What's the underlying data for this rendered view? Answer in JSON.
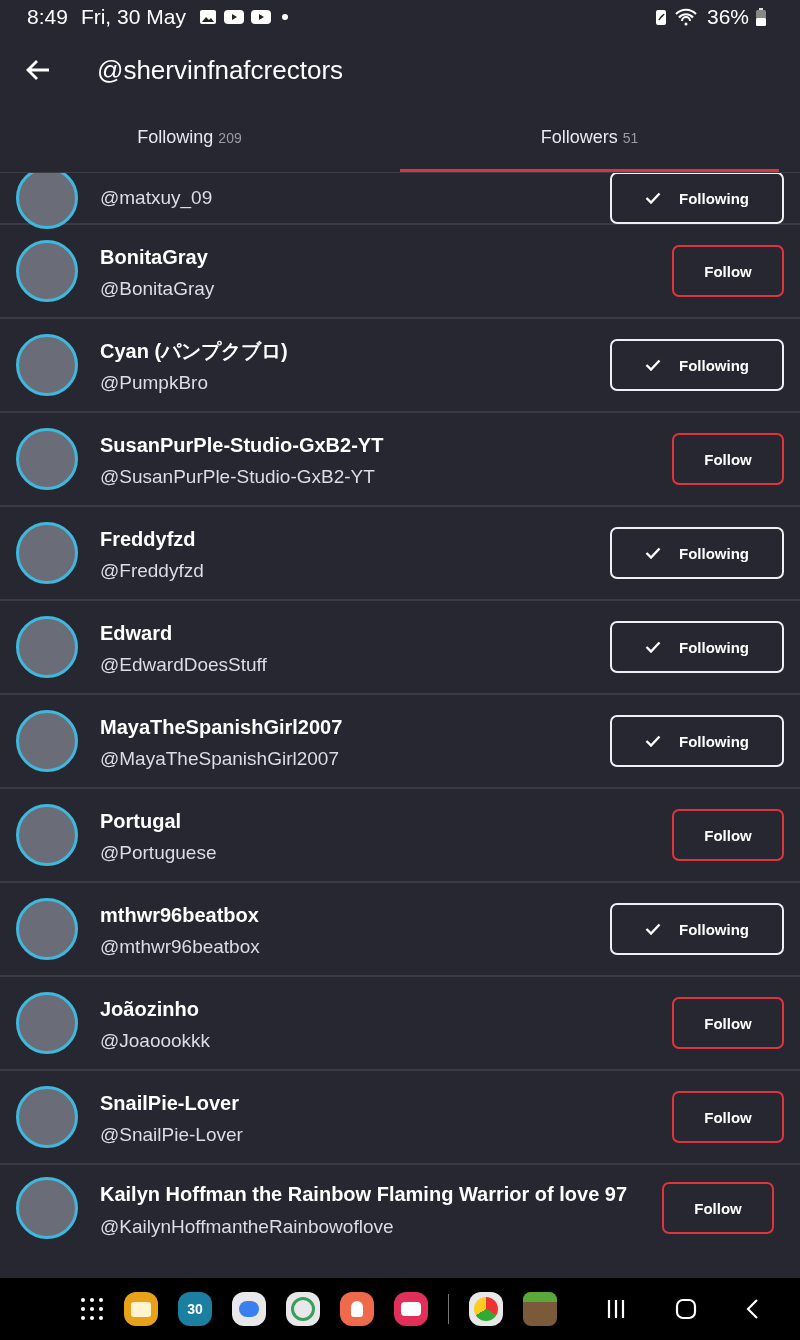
{
  "status_bar": {
    "time": "8:49",
    "date": "Fri, 30 May",
    "battery": "36%"
  },
  "header": {
    "title": "@shervinfnafcrectors"
  },
  "tabs": [
    {
      "label": "Following",
      "count": "209",
      "selected": false
    },
    {
      "label": "Followers",
      "count": "51",
      "selected": true
    }
  ],
  "users": [
    {
      "handle": "@matxuy_09",
      "following": true,
      "button": "Following"
    },
    {
      "name": "BonitaGray",
      "handle": "@BonitaGray",
      "following": false,
      "button": "Follow"
    },
    {
      "name": "Cyan (パンプクブロ)",
      "handle": "@PumpkBro",
      "following": true,
      "button": "Following"
    },
    {
      "name": "SusanPurPle-Studio-GxB2-YT",
      "handle": "@SusanPurPle-Studio-GxB2-YT",
      "following": false,
      "button": "Follow"
    },
    {
      "name": "Freddyfzd",
      "handle": "@Freddyfzd",
      "following": true,
      "button": "Following"
    },
    {
      "name": "Edward",
      "handle": "@EdwardDoesStuff",
      "following": true,
      "button": "Following"
    },
    {
      "name": "MayaTheSpanishGirl2007",
      "handle": "@MayaTheSpanishGirl2007",
      "following": true,
      "button": "Following"
    },
    {
      "name": "Portugal",
      "handle": "@Portuguese",
      "following": false,
      "button": "Follow"
    },
    {
      "name": "mthwr96beatbox",
      "handle": "@mthwr96beatbox",
      "following": true,
      "button": "Following"
    },
    {
      "name": "Joãozinho",
      "handle": "@Joaoookkk",
      "following": false,
      "button": "Follow"
    },
    {
      "name": "SnailPie-Lover",
      "handle": "@SnailPie-Lover",
      "following": false,
      "button": "Follow"
    },
    {
      "name": "Kailyn Hoffman the Rainbow Flaming Warrior of love 97",
      "handle": "@KailynHoffmantheRainbowoflove",
      "following": false,
      "button": "Follow"
    }
  ],
  "nav_bar": {
    "calendar_day": "30"
  }
}
